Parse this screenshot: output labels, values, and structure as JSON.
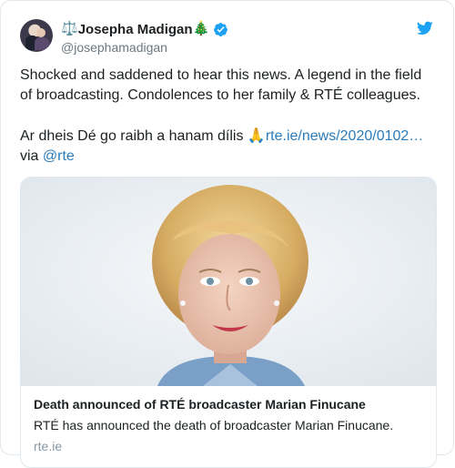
{
  "tweet": {
    "author": {
      "emoji_prefix": "⚖️",
      "display_name": "Josepha Madigan",
      "emoji_suffix": "🎄",
      "handle": "@josephamadigan",
      "verified": true,
      "avatar_icon": "avatar-photo"
    },
    "twitter_icon": "twitter-bird-icon",
    "text": {
      "line1": "Shocked and saddened to hear this news. A legend in the field",
      "line2": "of broadcasting. Condolences to her family & RTÉ colleagues.",
      "line3_text": "Ar dheis Dé go raibh a hanam dílis ",
      "line3_emoji": "🙏",
      "line3_link": "rte.ie/news/2020/0102…",
      "line4_text": "via ",
      "line4_mention": "@rte"
    },
    "card": {
      "image_icon": "portrait-photo",
      "title": "Death announced of RTÉ broadcaster Marian Finucane",
      "description": "RTÉ has announced the death of broadcaster Marian Finucane.",
      "domain": "rte.ie"
    },
    "colors": {
      "link": "#2b7bb9",
      "verified": "#1da1f2",
      "twitter_blue": "#1da1f2",
      "muted": "#697882"
    }
  }
}
